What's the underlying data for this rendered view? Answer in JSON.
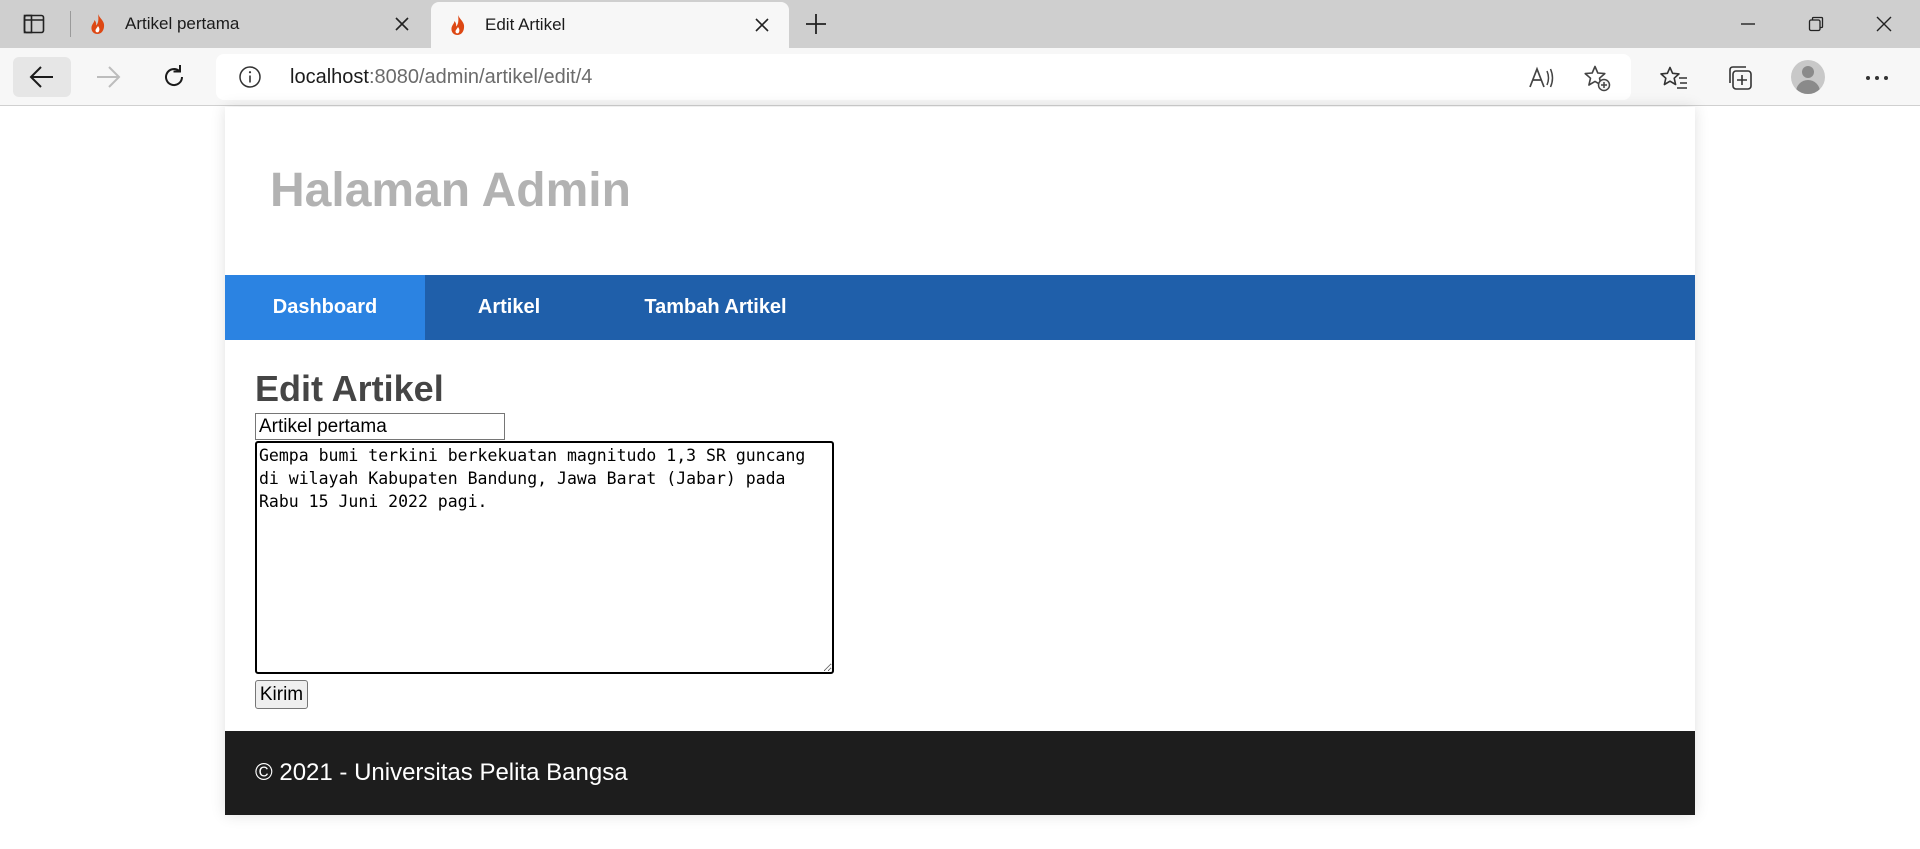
{
  "browser": {
    "tabs": [
      {
        "title": "Artikel pertama",
        "favicon": "flame-icon",
        "active": false
      },
      {
        "title": "Edit Artikel",
        "favicon": "flame-icon",
        "active": true
      }
    ],
    "address": {
      "host": "localhost",
      "path": ":8080/admin/artikel/edit/4"
    },
    "colors": {
      "chrome_bg": "#cfcfcf",
      "toolbar_bg": "#f7f7f7"
    }
  },
  "page": {
    "header_title": "Halaman Admin",
    "nav": [
      {
        "label": "Dashboard",
        "active": true
      },
      {
        "label": "Artikel",
        "active": false
      },
      {
        "label": "Tambah Artikel",
        "active": false
      }
    ],
    "heading": "Edit Artikel",
    "form": {
      "title_value": "Artikel pertama",
      "body_value": "Gempa bumi terkini berkekuatan magnitudo 1,3 SR guncang di wilayah Kabupaten Bandung, Jawa Barat (Jabar) pada Rabu 15 Juni 2022 pagi.",
      "submit_label": "Kirim"
    },
    "footer_text": "© 2021 - Universitas Pelita Bangsa",
    "colors": {
      "nav_bg": "#1f5faa",
      "nav_active": "#2b83e2",
      "footer_bg": "#1d1d1d",
      "header_text": "#b2b2b2"
    }
  }
}
